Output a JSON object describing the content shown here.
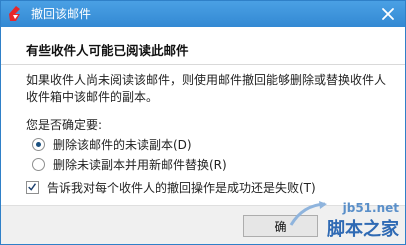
{
  "window": {
    "title": "撤回该邮件",
    "icon": "app-logo-icon",
    "close_icon": "close-icon"
  },
  "heading": "有些收件人可能已阅读此邮件",
  "description": "如果收件人尚未阅读该邮件，则使用邮件撤回能够删除或替换收件人收件箱中该邮件的副本。",
  "question": "您是否确定要:",
  "options": [
    {
      "type": "radio",
      "label": "删除该邮件的未读副本(D)",
      "selected": true
    },
    {
      "type": "radio",
      "label": "删除未读副本并用新邮件替换(R)",
      "selected": false
    }
  ],
  "notify_checkbox": {
    "label": "告诉我对每个收件人的撤回操作是成功还是失败(T)",
    "checked": true
  },
  "footer": {
    "ok_label": "确"
  },
  "watermark": {
    "site": "jb51.net",
    "brand": "脚本之家"
  },
  "colors": {
    "titlebar": "#3389d3",
    "accent": "#1c5180",
    "logo": "#e8262a"
  }
}
